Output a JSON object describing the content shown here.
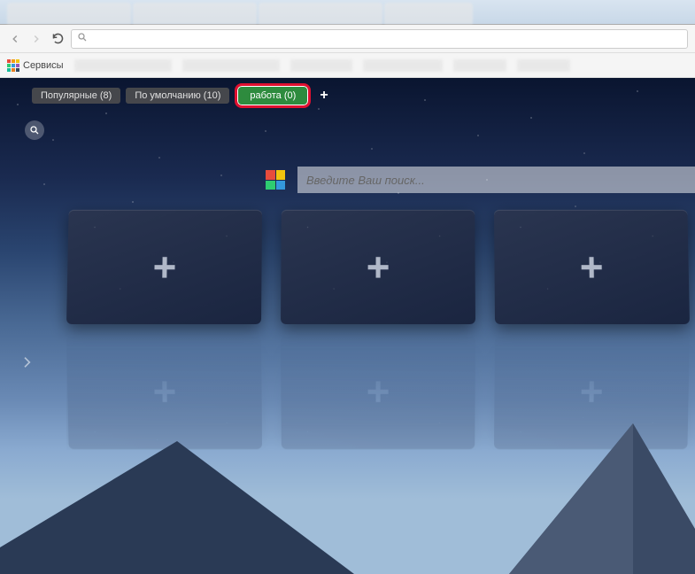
{
  "bookmarks": {
    "services_label": "Сервисы"
  },
  "groups": {
    "items": [
      {
        "label": "Популярные (8)"
      },
      {
        "label": "По умолчанию (10)"
      },
      {
        "label": "работа (0)"
      }
    ],
    "add_label": "+"
  },
  "search": {
    "placeholder": "Введите Ваш поиск..."
  },
  "tiles": {
    "plus": "+"
  }
}
